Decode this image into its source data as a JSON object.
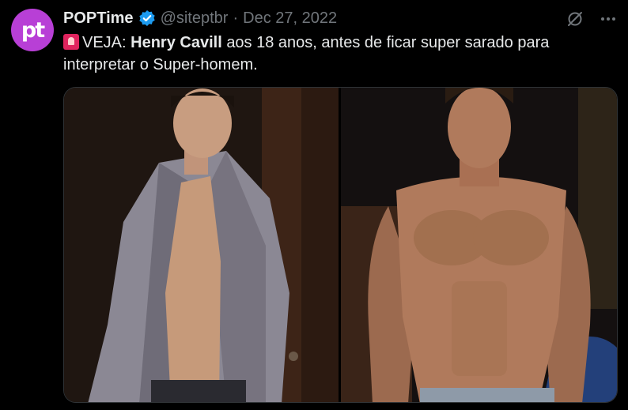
{
  "author": {
    "avatar_text": "pt",
    "avatar_color": "#b83fd6",
    "name": "POPTime",
    "verified": true,
    "handle": "@siteptbr",
    "separator": "·",
    "date": "Dec 27, 2022"
  },
  "tweet": {
    "prefix_icon": "police-siren-icon",
    "text_part1": "VEJA:",
    "text_bold": "Henry Cavill",
    "text_part2": "aos 18 anos, antes de ficar super sarado para interpretar o Super-homem."
  },
  "actions": {
    "grok_icon": "grok-icon",
    "more_icon": "more-dots-icon"
  },
  "media": {
    "images": [
      {
        "name": "photo-left-young"
      },
      {
        "name": "photo-right-muscular"
      }
    ]
  },
  "colors": {
    "background": "#000000",
    "text": "#e7e9ea",
    "secondary": "#71767b",
    "verified": "#1d9bf0"
  }
}
